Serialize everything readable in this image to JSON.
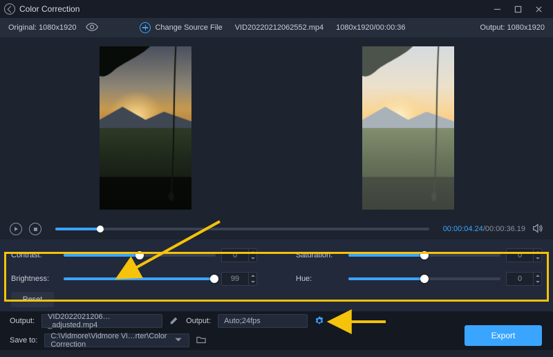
{
  "app": {
    "title": "Color Correction"
  },
  "infobar": {
    "original_label": "Original:",
    "original_res": "1080x1920",
    "change_source_label": "Change Source File",
    "filename": "VID20220212062552.mp4",
    "file_meta": "1080x1920/00:00:36",
    "output_label": "Output:",
    "output_res": "1080x1920"
  },
  "playback": {
    "current_time": "00:00:04.24",
    "duration": "00:00:36.19",
    "progress_pct": 12
  },
  "corrections": {
    "contrast": {
      "label": "Contrast:",
      "value": "0",
      "pct": 50
    },
    "brightness": {
      "label": "Brightness:",
      "value": "99",
      "pct": 99
    },
    "saturation": {
      "label": "Saturation:",
      "value": "0",
      "pct": 50
    },
    "hue": {
      "label": "Hue:",
      "value": "0",
      "pct": 50
    },
    "reset_label": "Reset"
  },
  "output": {
    "file_label": "Output:",
    "file_value": "VID2022021206…_adjusted.mp4",
    "fmt_label": "Output:",
    "fmt_value": "Auto;24fps",
    "save_label": "Save to:",
    "save_path": "C:\\Vidmore\\Vidmore Vi…rter\\Color Correction",
    "export_label": "Export"
  },
  "chart_data": null
}
